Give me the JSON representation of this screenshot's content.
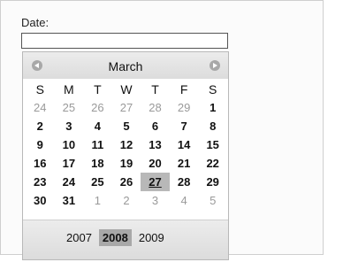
{
  "date_field": {
    "label": "Date:",
    "value": ""
  },
  "calendar": {
    "month": "March",
    "prev_icon": "chevron-left-icon",
    "next_icon": "chevron-right-icon",
    "weekdays": [
      "S",
      "M",
      "T",
      "W",
      "T",
      "F",
      "S"
    ],
    "weeks": [
      [
        {
          "d": "24",
          "o": true
        },
        {
          "d": "25",
          "o": true
        },
        {
          "d": "26",
          "o": true
        },
        {
          "d": "27",
          "o": true
        },
        {
          "d": "28",
          "o": true
        },
        {
          "d": "29",
          "o": true
        },
        {
          "d": "1",
          "o": false
        }
      ],
      [
        {
          "d": "2",
          "o": false
        },
        {
          "d": "3",
          "o": false
        },
        {
          "d": "4",
          "o": false
        },
        {
          "d": "5",
          "o": false
        },
        {
          "d": "6",
          "o": false
        },
        {
          "d": "7",
          "o": false
        },
        {
          "d": "8",
          "o": false
        }
      ],
      [
        {
          "d": "9",
          "o": false
        },
        {
          "d": "10",
          "o": false
        },
        {
          "d": "11",
          "o": false
        },
        {
          "d": "12",
          "o": false
        },
        {
          "d": "13",
          "o": false
        },
        {
          "d": "14",
          "o": false
        },
        {
          "d": "15",
          "o": false
        }
      ],
      [
        {
          "d": "16",
          "o": false
        },
        {
          "d": "17",
          "o": false
        },
        {
          "d": "18",
          "o": false
        },
        {
          "d": "19",
          "o": false
        },
        {
          "d": "20",
          "o": false
        },
        {
          "d": "21",
          "o": false
        },
        {
          "d": "22",
          "o": false
        }
      ],
      [
        {
          "d": "23",
          "o": false
        },
        {
          "d": "24",
          "o": false
        },
        {
          "d": "25",
          "o": false
        },
        {
          "d": "26",
          "o": false
        },
        {
          "d": "27",
          "o": false,
          "selected": true
        },
        {
          "d": "28",
          "o": false
        },
        {
          "d": "29",
          "o": false
        }
      ],
      [
        {
          "d": "30",
          "o": false
        },
        {
          "d": "31",
          "o": false
        },
        {
          "d": "1",
          "o": true
        },
        {
          "d": "2",
          "o": true
        },
        {
          "d": "3",
          "o": true
        },
        {
          "d": "4",
          "o": true
        },
        {
          "d": "5",
          "o": true
        }
      ]
    ],
    "years": [
      {
        "label": "2007",
        "selected": false
      },
      {
        "label": "2008",
        "selected": true
      },
      {
        "label": "2009",
        "selected": false
      }
    ]
  },
  "colors": {
    "selected_bg": "#b8b8b8",
    "other_month_text": "#9a9a9a",
    "header_bg": "#e4e4e4"
  }
}
